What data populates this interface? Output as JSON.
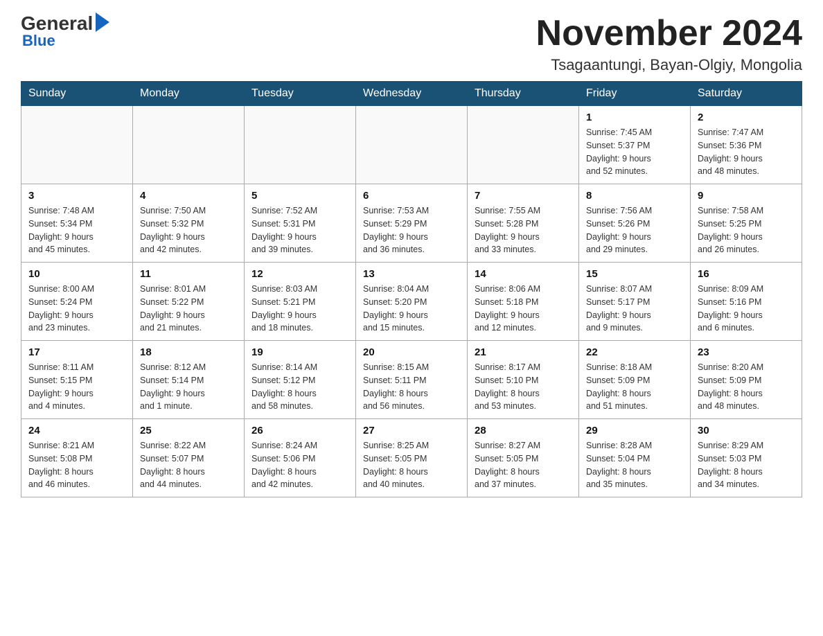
{
  "logo": {
    "general": "General",
    "blue": "Blue"
  },
  "header": {
    "title": "November 2024",
    "subtitle": "Tsagaantungi, Bayan-Olgiy, Mongolia"
  },
  "weekdays": [
    "Sunday",
    "Monday",
    "Tuesday",
    "Wednesday",
    "Thursday",
    "Friday",
    "Saturday"
  ],
  "weeks": [
    [
      {
        "day": "",
        "info": ""
      },
      {
        "day": "",
        "info": ""
      },
      {
        "day": "",
        "info": ""
      },
      {
        "day": "",
        "info": ""
      },
      {
        "day": "",
        "info": ""
      },
      {
        "day": "1",
        "info": "Sunrise: 7:45 AM\nSunset: 5:37 PM\nDaylight: 9 hours\nand 52 minutes."
      },
      {
        "day": "2",
        "info": "Sunrise: 7:47 AM\nSunset: 5:36 PM\nDaylight: 9 hours\nand 48 minutes."
      }
    ],
    [
      {
        "day": "3",
        "info": "Sunrise: 7:48 AM\nSunset: 5:34 PM\nDaylight: 9 hours\nand 45 minutes."
      },
      {
        "day": "4",
        "info": "Sunrise: 7:50 AM\nSunset: 5:32 PM\nDaylight: 9 hours\nand 42 minutes."
      },
      {
        "day": "5",
        "info": "Sunrise: 7:52 AM\nSunset: 5:31 PM\nDaylight: 9 hours\nand 39 minutes."
      },
      {
        "day": "6",
        "info": "Sunrise: 7:53 AM\nSunset: 5:29 PM\nDaylight: 9 hours\nand 36 minutes."
      },
      {
        "day": "7",
        "info": "Sunrise: 7:55 AM\nSunset: 5:28 PM\nDaylight: 9 hours\nand 33 minutes."
      },
      {
        "day": "8",
        "info": "Sunrise: 7:56 AM\nSunset: 5:26 PM\nDaylight: 9 hours\nand 29 minutes."
      },
      {
        "day": "9",
        "info": "Sunrise: 7:58 AM\nSunset: 5:25 PM\nDaylight: 9 hours\nand 26 minutes."
      }
    ],
    [
      {
        "day": "10",
        "info": "Sunrise: 8:00 AM\nSunset: 5:24 PM\nDaylight: 9 hours\nand 23 minutes."
      },
      {
        "day": "11",
        "info": "Sunrise: 8:01 AM\nSunset: 5:22 PM\nDaylight: 9 hours\nand 21 minutes."
      },
      {
        "day": "12",
        "info": "Sunrise: 8:03 AM\nSunset: 5:21 PM\nDaylight: 9 hours\nand 18 minutes."
      },
      {
        "day": "13",
        "info": "Sunrise: 8:04 AM\nSunset: 5:20 PM\nDaylight: 9 hours\nand 15 minutes."
      },
      {
        "day": "14",
        "info": "Sunrise: 8:06 AM\nSunset: 5:18 PM\nDaylight: 9 hours\nand 12 minutes."
      },
      {
        "day": "15",
        "info": "Sunrise: 8:07 AM\nSunset: 5:17 PM\nDaylight: 9 hours\nand 9 minutes."
      },
      {
        "day": "16",
        "info": "Sunrise: 8:09 AM\nSunset: 5:16 PM\nDaylight: 9 hours\nand 6 minutes."
      }
    ],
    [
      {
        "day": "17",
        "info": "Sunrise: 8:11 AM\nSunset: 5:15 PM\nDaylight: 9 hours\nand 4 minutes."
      },
      {
        "day": "18",
        "info": "Sunrise: 8:12 AM\nSunset: 5:14 PM\nDaylight: 9 hours\nand 1 minute."
      },
      {
        "day": "19",
        "info": "Sunrise: 8:14 AM\nSunset: 5:12 PM\nDaylight: 8 hours\nand 58 minutes."
      },
      {
        "day": "20",
        "info": "Sunrise: 8:15 AM\nSunset: 5:11 PM\nDaylight: 8 hours\nand 56 minutes."
      },
      {
        "day": "21",
        "info": "Sunrise: 8:17 AM\nSunset: 5:10 PM\nDaylight: 8 hours\nand 53 minutes."
      },
      {
        "day": "22",
        "info": "Sunrise: 8:18 AM\nSunset: 5:09 PM\nDaylight: 8 hours\nand 51 minutes."
      },
      {
        "day": "23",
        "info": "Sunrise: 8:20 AM\nSunset: 5:09 PM\nDaylight: 8 hours\nand 48 minutes."
      }
    ],
    [
      {
        "day": "24",
        "info": "Sunrise: 8:21 AM\nSunset: 5:08 PM\nDaylight: 8 hours\nand 46 minutes."
      },
      {
        "day": "25",
        "info": "Sunrise: 8:22 AM\nSunset: 5:07 PM\nDaylight: 8 hours\nand 44 minutes."
      },
      {
        "day": "26",
        "info": "Sunrise: 8:24 AM\nSunset: 5:06 PM\nDaylight: 8 hours\nand 42 minutes."
      },
      {
        "day": "27",
        "info": "Sunrise: 8:25 AM\nSunset: 5:05 PM\nDaylight: 8 hours\nand 40 minutes."
      },
      {
        "day": "28",
        "info": "Sunrise: 8:27 AM\nSunset: 5:05 PM\nDaylight: 8 hours\nand 37 minutes."
      },
      {
        "day": "29",
        "info": "Sunrise: 8:28 AM\nSunset: 5:04 PM\nDaylight: 8 hours\nand 35 minutes."
      },
      {
        "day": "30",
        "info": "Sunrise: 8:29 AM\nSunset: 5:03 PM\nDaylight: 8 hours\nand 34 minutes."
      }
    ]
  ]
}
